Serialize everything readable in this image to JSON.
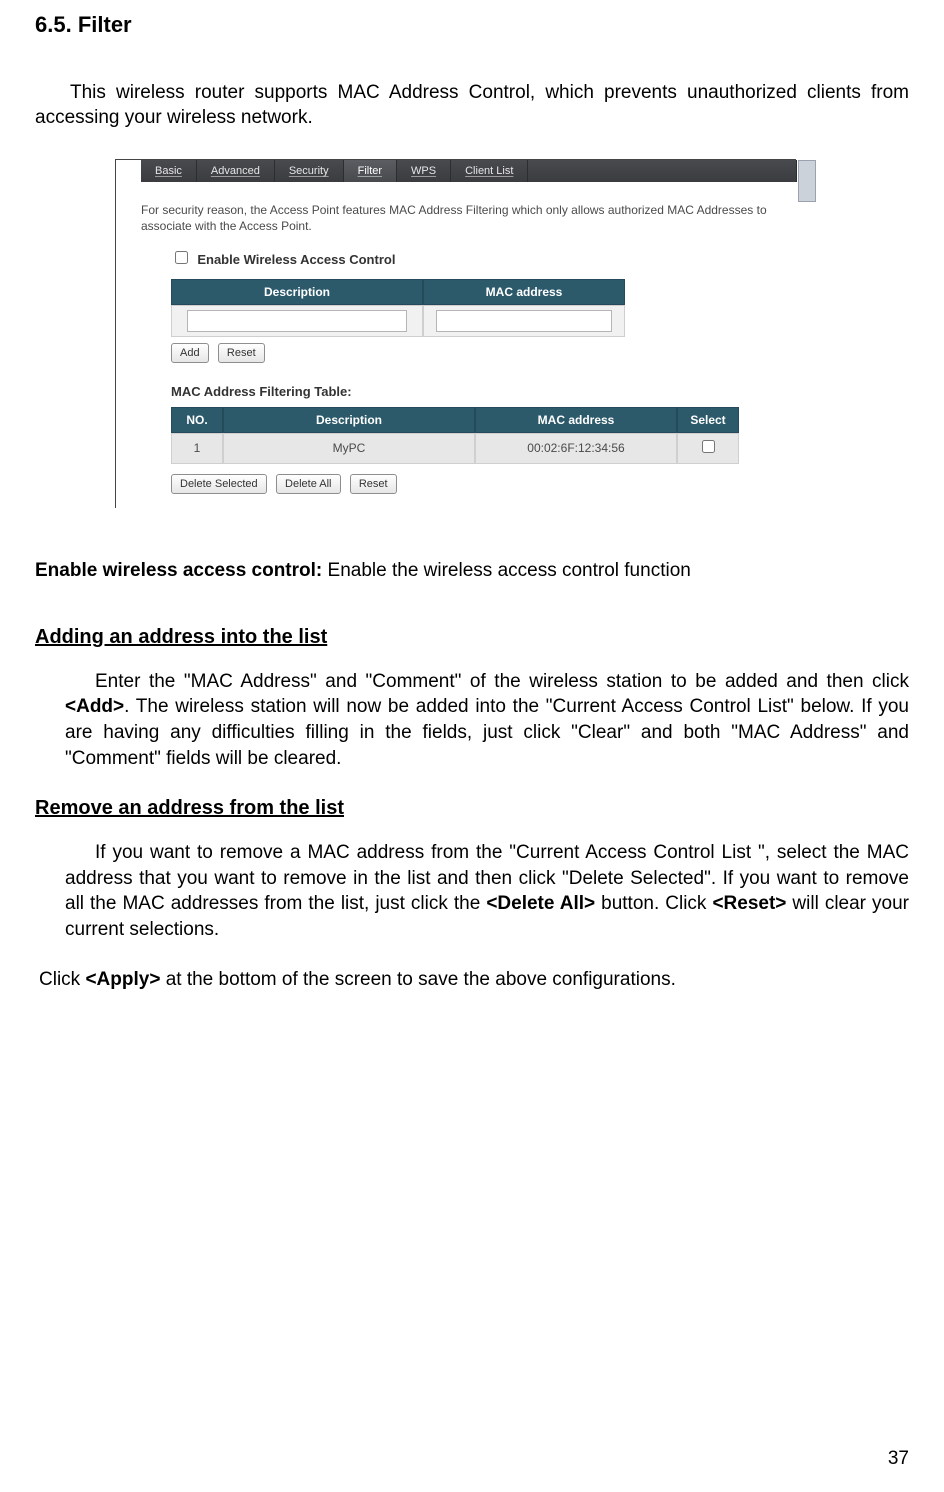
{
  "section": {
    "number": "6.5.",
    "title": "Filter"
  },
  "intro": "This wireless router supports MAC Address Control, which prevents unauthorized clients from accessing your wireless network.",
  "panel": {
    "tabs": {
      "basic": "Basic",
      "advanced": "Advanced",
      "security": "Security",
      "filter": "Filter",
      "wps": "WPS",
      "clientlist": "Client List"
    },
    "description": "For security reason, the Access Point features MAC Address Filtering which only allows authorized MAC Addresses to associate with the Access Point.",
    "enable_label": "Enable Wireless Access Control",
    "form_headers": {
      "description": "Description",
      "mac": "MAC address"
    },
    "buttons": {
      "add": "Add",
      "reset": "Reset"
    },
    "table_title": "MAC Address Filtering Table:",
    "data_headers": {
      "no": "NO.",
      "description": "Description",
      "mac": "MAC address",
      "select": "Select"
    },
    "row1": {
      "no": "1",
      "description": "MyPC",
      "mac": "00:02:6F:12:34:56"
    },
    "footer_buttons": {
      "delete_selected": "Delete Selected",
      "delete_all": "Delete All",
      "reset": "Reset"
    }
  },
  "enable_line": {
    "label": "Enable wireless access control:",
    "text": " Enable the wireless access control function"
  },
  "sub_add": "Adding an address into the list",
  "para_add_1": "Enter the \"MAC Address\" and \"Comment\" of the wireless station to be added and then click ",
  "para_add_add": "<Add>",
  "para_add_2": ". The wireless station will now be added into the \"Current Access Control List\" below. If you are having any difficulties filling in the fields, just click \"Clear\" and both \"MAC Address\" and \"Comment\" fields will be cleared.",
  "sub_remove": "Remove an address from the list",
  "para_remove_1": "If you want to remove a MAC address from the \"Current Access Control List \", select the MAC address that you want to remove in the list and then click \"Delete Selected\". If you want to remove all the MAC addresses from the list, just click the ",
  "para_remove_dall": "<Delete All>",
  "para_remove_2": " button. Click ",
  "para_remove_reset": "<Reset>",
  "para_remove_3": " will clear your current selections.",
  "apply_line_1": "Click ",
  "apply_bold": "<Apply>",
  "apply_line_2": " at the bottom of the screen to save the above configurations.",
  "page_number": "37"
}
